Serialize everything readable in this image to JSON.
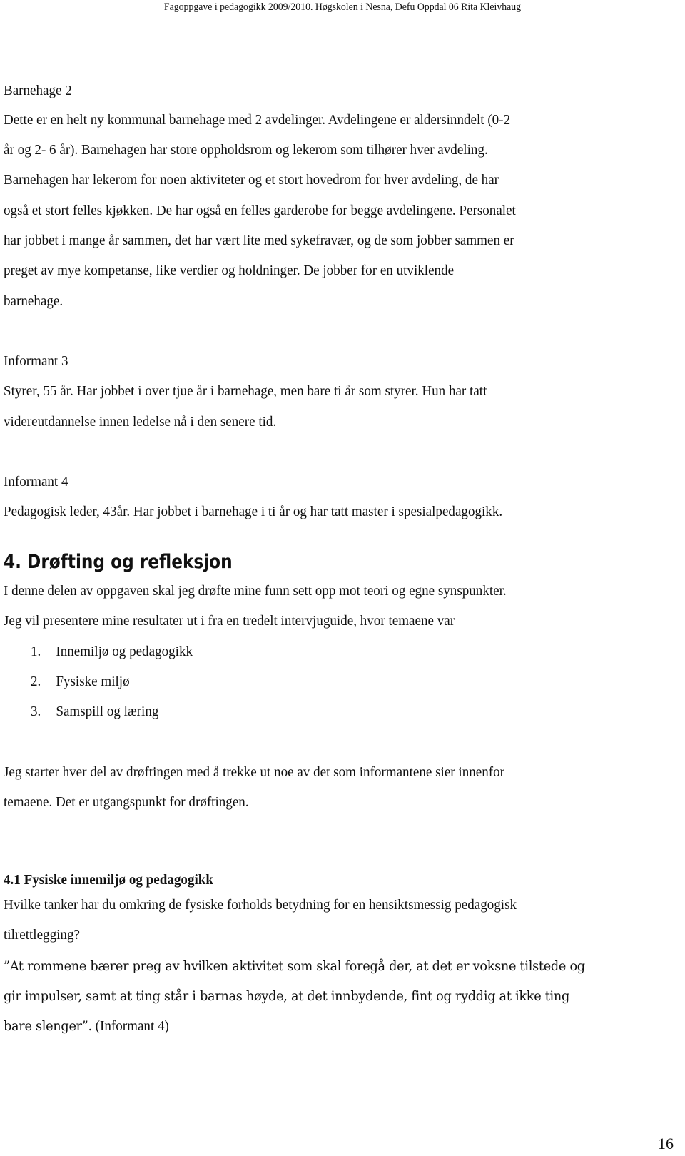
{
  "header": {
    "running_title": "Fagoppgave i pedagogikk 2009/2010.  Høgskolen i Nesna, Defu Oppdal 06 Rita Kleivhaug"
  },
  "sections": {
    "barnehage2": {
      "title": "Barnehage 2",
      "lines": [
        "Dette er en helt ny kommunal barnehage med 2 avdelinger. Avdelingene er aldersinndelt (0-2",
        "år og 2- 6 år). Barnehagen har store oppholdsrom og lekerom som tilhører hver avdeling.",
        "Barnehagen har lekerom for noen aktiviteter og et stort hovedrom for hver avdeling, de har",
        "også et stort felles kjøkken. De har også en felles garderobe for begge avdelingene. Personalet",
        "har jobbet i mange år sammen, det har vært lite med sykefravær, og de som jobber sammen er",
        "preget av mye kompetanse, like verdier og holdninger.  De jobber for en utviklende",
        "barnehage."
      ]
    },
    "informant3": {
      "title": "Informant 3",
      "lines": [
        "Styrer, 55 år. Har jobbet i over tjue år i barnehage, men bare ti år som styrer. Hun har tatt",
        "videreutdannelse innen ledelse nå i den senere tid."
      ]
    },
    "informant4": {
      "title": "Informant 4",
      "lines": [
        "Pedagogisk leder, 43år. Har jobbet i barnehage i ti år og har tatt master i spesialpedagogikk."
      ]
    },
    "chapter4": {
      "heading": "4. Drøfting og refleksjon",
      "lines": [
        "I denne delen av oppgaven skal jeg drøfte mine funn sett opp mot teori og egne synspunkter.",
        "Jeg vil presentere mine resultater ut i fra en tredelt intervjuguide, hvor temaene var"
      ],
      "list": [
        {
          "num": "1.",
          "text": "Innemiljø og pedagogikk"
        },
        {
          "num": "2.",
          "text": "Fysiske miljø"
        },
        {
          "num": "3.",
          "text": "Samspill og læring"
        }
      ],
      "after_lines": [
        "Jeg starter hver del av drøftingen med å trekke ut noe av det som informantene sier innenfor",
        "temaene.  Det er utgangspunkt for drøftingen."
      ]
    },
    "section41": {
      "heading": "4.1 Fysiske innemiljø og pedagogikk",
      "question_lines": [
        "Hvilke tanker har du omkring de fysiske forholds betydning for en hensiktsmessig pedagogisk",
        "tilrettlegging?"
      ],
      "quote_lines": [
        "”At rommene bærer preg av hvilken aktivitet som skal foregå der, at det er voksne tilstede og",
        "gir impulser, samt at ting står i barnas høyde, at det innbydende, fint og ryddig at ikke ting",
        "bare slenger”."
      ],
      "quote_source": " (Informant 4)"
    }
  },
  "footer": {
    "page_number": "16"
  }
}
